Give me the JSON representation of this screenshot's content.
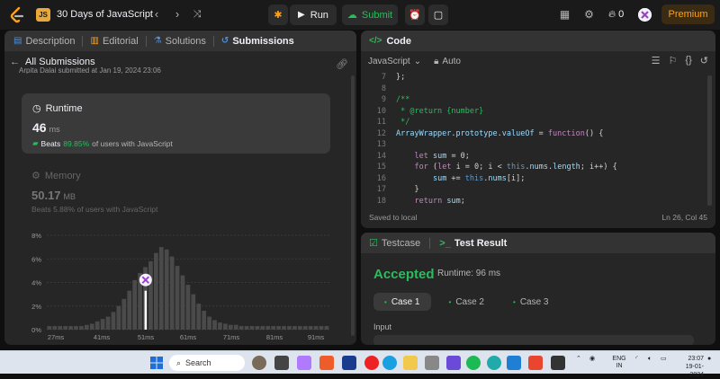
{
  "topbar": {
    "js_badge": "JS",
    "study_title": "30 Days of JavaScript",
    "run_label": "Run",
    "submit_label": "Submit",
    "streak_count": "0",
    "premium_label": "Premium"
  },
  "left_tabs": [
    {
      "label": "Description",
      "icon": "description-icon"
    },
    {
      "label": "Editorial",
      "icon": "editorial-icon"
    },
    {
      "label": "Solutions",
      "icon": "solutions-icon"
    },
    {
      "label": "Submissions",
      "icon": "submissions-icon"
    }
  ],
  "submissions": {
    "back_label": "All Submissions",
    "author_line": "Arpita Dalai  submitted at Jan 19, 2024 23:06"
  },
  "runtime": {
    "title": "Runtime",
    "value": "46",
    "unit": "ms",
    "beats_prefix": "Beats",
    "beats_pct": "89.85%",
    "beats_suffix": "of users with JavaScript"
  },
  "memory": {
    "title": "Memory",
    "value": "50.17",
    "unit": "MB",
    "beats": "Beats 5.88% of users with JavaScript"
  },
  "chart_data": {
    "type": "bar",
    "y_tick_labels": [
      "8%",
      "6%",
      "4%",
      "2%",
      "0%"
    ],
    "x_tick_labels": [
      "27ms",
      "41ms",
      "51ms",
      "61ms",
      "71ms",
      "81ms",
      "91ms"
    ],
    "ylim": [
      0,
      8
    ],
    "values": [
      0.3,
      0.3,
      0.3,
      0.3,
      0.3,
      0.3,
      0.3,
      0.4,
      0.5,
      0.7,
      0.9,
      1.1,
      1.5,
      2.0,
      2.6,
      3.3,
      4.2,
      4.8,
      5.3,
      5.8,
      6.5,
      7.0,
      6.8,
      6.2,
      5.4,
      4.6,
      3.8,
      3.0,
      2.2,
      1.6,
      1.1,
      0.8,
      0.6,
      0.5,
      0.4,
      0.4,
      0.3,
      0.3,
      0.3,
      0.3,
      0.3,
      0.3,
      0.3,
      0.3,
      0.3,
      0.3,
      0.3,
      0.3,
      0.3,
      0.3,
      0.3,
      0.3,
      0.3
    ],
    "highlight_index": 18,
    "highlight_value": 3.3
  },
  "code": {
    "title": "Code",
    "language": "JavaScript",
    "mode": "Auto",
    "lines": [
      {
        "n": "7",
        "t": "};"
      },
      {
        "n": "8",
        "t": ""
      },
      {
        "n": "9",
        "t": "/**"
      },
      {
        "n": "10",
        "t": " * @return {number}"
      },
      {
        "n": "11",
        "t": " */"
      },
      {
        "n": "12",
        "t": "ArrayWrapper.prototype.valueOf = function() {"
      },
      {
        "n": "13",
        "t": ""
      },
      {
        "n": "14",
        "t": "    let sum = 0;"
      },
      {
        "n": "15",
        "t": "    for (let i = 0; i < this.nums.length; i++) {"
      },
      {
        "n": "16",
        "t": "        sum += this.nums[i];"
      },
      {
        "n": "17",
        "t": "    }"
      },
      {
        "n": "18",
        "t": "    return sum;"
      }
    ],
    "saved": "Saved to local",
    "cursor": "Ln 26, Col 45"
  },
  "result": {
    "testcase_tab": "Testcase",
    "result_tab": "Test Result",
    "status": "Accepted",
    "runtime": "Runtime: 96 ms",
    "cases": [
      "Case 1",
      "Case 2",
      "Case 3"
    ],
    "input_label": "Input"
  },
  "taskbar": {
    "search_label": "Search",
    "lang": "ENG",
    "region": "IN",
    "time": "23:07",
    "date": "19-01-2024"
  },
  "colors": {
    "accent_green": "#2cbb5d",
    "accent_orange": "#ffa116"
  }
}
